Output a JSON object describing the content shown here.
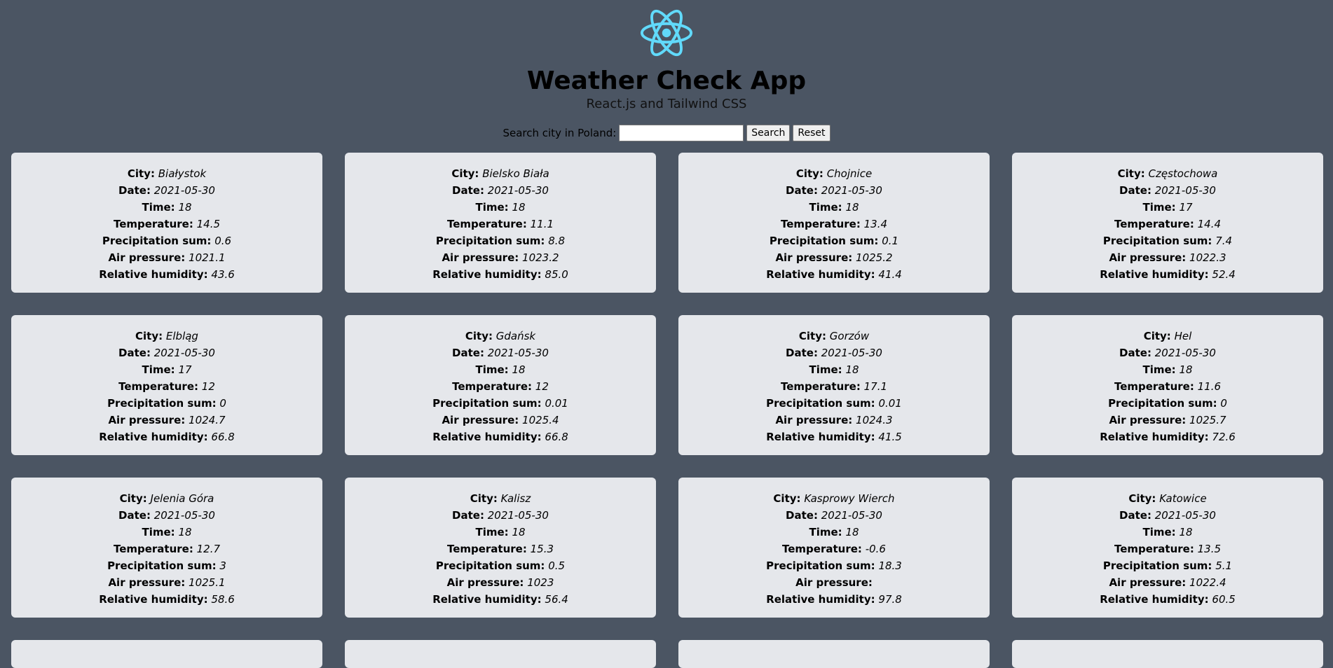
{
  "header": {
    "title": "Weather Check App",
    "subtitle": "React.js and Tailwind CSS",
    "logo_icon": "react-atom-icon",
    "logo_color": "#61dafb"
  },
  "search": {
    "label": "Search city in Poland:",
    "value": "",
    "placeholder": "",
    "search_button": "Search",
    "reset_button": "Reset"
  },
  "labels": {
    "city": "City:",
    "date": "Date:",
    "time": "Time:",
    "temperature": "Temperature:",
    "precipitation": "Precipitation sum:",
    "pressure": "Air pressure:",
    "humidity": "Relative humidity:"
  },
  "stations": [
    {
      "city": "Białystok",
      "date": "2021-05-30",
      "time": "18",
      "temperature": "14.5",
      "precipitation": "0.6",
      "pressure": "1021.1",
      "humidity": "43.6"
    },
    {
      "city": "Bielsko Biała",
      "date": "2021-05-30",
      "time": "18",
      "temperature": "11.1",
      "precipitation": "8.8",
      "pressure": "1023.2",
      "humidity": "85.0"
    },
    {
      "city": "Chojnice",
      "date": "2021-05-30",
      "time": "18",
      "temperature": "13.4",
      "precipitation": "0.1",
      "pressure": "1025.2",
      "humidity": "41.4"
    },
    {
      "city": "Częstochowa",
      "date": "2021-05-30",
      "time": "17",
      "temperature": "14.4",
      "precipitation": "7.4",
      "pressure": "1022.3",
      "humidity": "52.4"
    },
    {
      "city": "Elbląg",
      "date": "2021-05-30",
      "time": "17",
      "temperature": "12",
      "precipitation": "0",
      "pressure": "1024.7",
      "humidity": "66.8"
    },
    {
      "city": "Gdańsk",
      "date": "2021-05-30",
      "time": "18",
      "temperature": "12",
      "precipitation": "0.01",
      "pressure": "1025.4",
      "humidity": "66.8"
    },
    {
      "city": "Gorzów",
      "date": "2021-05-30",
      "time": "18",
      "temperature": "17.1",
      "precipitation": "0.01",
      "pressure": "1024.3",
      "humidity": "41.5"
    },
    {
      "city": "Hel",
      "date": "2021-05-30",
      "time": "18",
      "temperature": "11.6",
      "precipitation": "0",
      "pressure": "1025.7",
      "humidity": "72.6"
    },
    {
      "city": "Jelenia Góra",
      "date": "2021-05-30",
      "time": "18",
      "temperature": "12.7",
      "precipitation": "3",
      "pressure": "1025.1",
      "humidity": "58.6"
    },
    {
      "city": "Kalisz",
      "date": "2021-05-30",
      "time": "18",
      "temperature": "15.3",
      "precipitation": "0.5",
      "pressure": "1023",
      "humidity": "56.4"
    },
    {
      "city": "Kasprowy Wierch",
      "date": "2021-05-30",
      "time": "18",
      "temperature": "-0.6",
      "precipitation": "18.3",
      "pressure": "",
      "humidity": "97.8"
    },
    {
      "city": "Katowice",
      "date": "2021-05-30",
      "time": "18",
      "temperature": "13.5",
      "precipitation": "5.1",
      "pressure": "1022.4",
      "humidity": "60.5"
    }
  ]
}
